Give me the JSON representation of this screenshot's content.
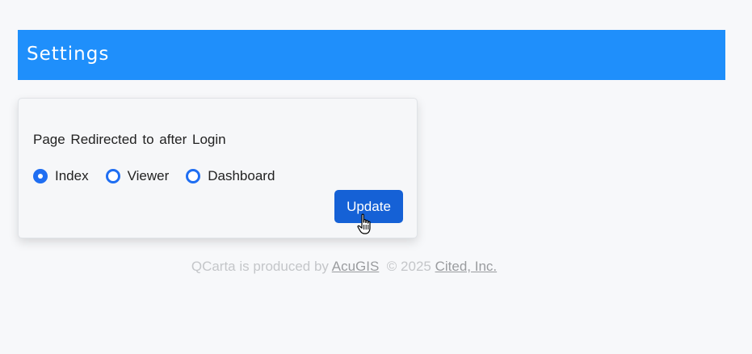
{
  "header": {
    "title": "Settings",
    "bar_color": "#1f8ffb"
  },
  "settings_card": {
    "heading": "Page Redirected to after Login",
    "options": [
      {
        "label": "Index",
        "checked": true
      },
      {
        "label": "Viewer",
        "checked": false
      },
      {
        "label": "Dashboard",
        "checked": false
      }
    ],
    "update_label": "Update",
    "accent_color": "#1f6ef2"
  },
  "footer": {
    "prefix": "QCarta is produced by",
    "link1": "AcuGIS",
    "copyright": "© 2025",
    "link2": "Cited, Inc."
  },
  "cursor": {
    "icon": "hand-pointer-icon"
  }
}
